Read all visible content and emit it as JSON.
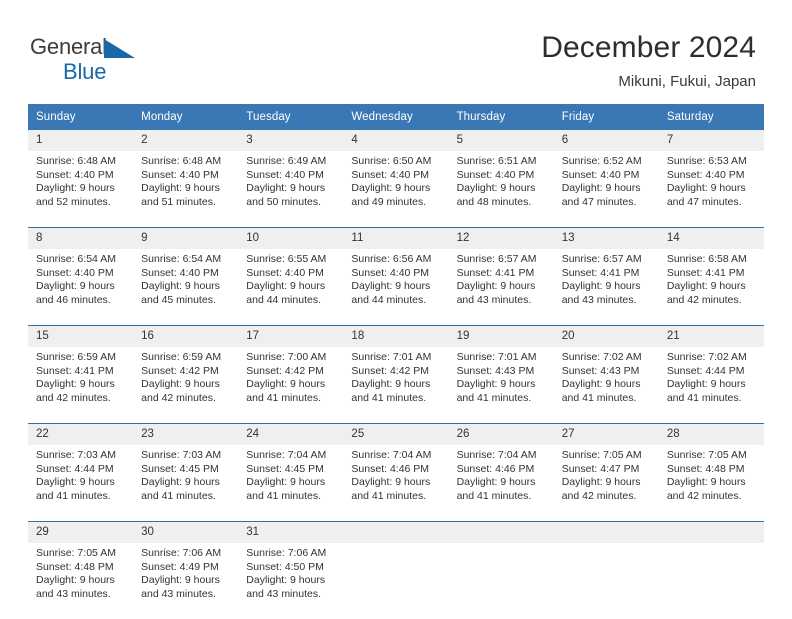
{
  "brand": {
    "name_part1": "General",
    "name_part2": "Blue",
    "logo_icon": "blue-triangle-flag-icon",
    "color_primary": "#1769aa"
  },
  "header": {
    "title": "December 2024",
    "subtitle": "Mikuni, Fukui, Japan"
  },
  "colors": {
    "header_blue": "#3a78b5",
    "separator_blue": "#2f6daf",
    "daynum_band": "#efefef",
    "text": "#333333"
  },
  "weekday_headers": [
    "Sunday",
    "Monday",
    "Tuesday",
    "Wednesday",
    "Thursday",
    "Friday",
    "Saturday"
  ],
  "weeks": [
    {
      "days": [
        {
          "num": "1",
          "sunrise": "Sunrise: 6:48 AM",
          "sunset": "Sunset: 4:40 PM",
          "daylight1": "Daylight: 9 hours",
          "daylight2": "and 52 minutes."
        },
        {
          "num": "2",
          "sunrise": "Sunrise: 6:48 AM",
          "sunset": "Sunset: 4:40 PM",
          "daylight1": "Daylight: 9 hours",
          "daylight2": "and 51 minutes."
        },
        {
          "num": "3",
          "sunrise": "Sunrise: 6:49 AM",
          "sunset": "Sunset: 4:40 PM",
          "daylight1": "Daylight: 9 hours",
          "daylight2": "and 50 minutes."
        },
        {
          "num": "4",
          "sunrise": "Sunrise: 6:50 AM",
          "sunset": "Sunset: 4:40 PM",
          "daylight1": "Daylight: 9 hours",
          "daylight2": "and 49 minutes."
        },
        {
          "num": "5",
          "sunrise": "Sunrise: 6:51 AM",
          "sunset": "Sunset: 4:40 PM",
          "daylight1": "Daylight: 9 hours",
          "daylight2": "and 48 minutes."
        },
        {
          "num": "6",
          "sunrise": "Sunrise: 6:52 AM",
          "sunset": "Sunset: 4:40 PM",
          "daylight1": "Daylight: 9 hours",
          "daylight2": "and 47 minutes."
        },
        {
          "num": "7",
          "sunrise": "Sunrise: 6:53 AM",
          "sunset": "Sunset: 4:40 PM",
          "daylight1": "Daylight: 9 hours",
          "daylight2": "and 47 minutes."
        }
      ]
    },
    {
      "days": [
        {
          "num": "8",
          "sunrise": "Sunrise: 6:54 AM",
          "sunset": "Sunset: 4:40 PM",
          "daylight1": "Daylight: 9 hours",
          "daylight2": "and 46 minutes."
        },
        {
          "num": "9",
          "sunrise": "Sunrise: 6:54 AM",
          "sunset": "Sunset: 4:40 PM",
          "daylight1": "Daylight: 9 hours",
          "daylight2": "and 45 minutes."
        },
        {
          "num": "10",
          "sunrise": "Sunrise: 6:55 AM",
          "sunset": "Sunset: 4:40 PM",
          "daylight1": "Daylight: 9 hours",
          "daylight2": "and 44 minutes."
        },
        {
          "num": "11",
          "sunrise": "Sunrise: 6:56 AM",
          "sunset": "Sunset: 4:40 PM",
          "daylight1": "Daylight: 9 hours",
          "daylight2": "and 44 minutes."
        },
        {
          "num": "12",
          "sunrise": "Sunrise: 6:57 AM",
          "sunset": "Sunset: 4:41 PM",
          "daylight1": "Daylight: 9 hours",
          "daylight2": "and 43 minutes."
        },
        {
          "num": "13",
          "sunrise": "Sunrise: 6:57 AM",
          "sunset": "Sunset: 4:41 PM",
          "daylight1": "Daylight: 9 hours",
          "daylight2": "and 43 minutes."
        },
        {
          "num": "14",
          "sunrise": "Sunrise: 6:58 AM",
          "sunset": "Sunset: 4:41 PM",
          "daylight1": "Daylight: 9 hours",
          "daylight2": "and 42 minutes."
        }
      ]
    },
    {
      "days": [
        {
          "num": "15",
          "sunrise": "Sunrise: 6:59 AM",
          "sunset": "Sunset: 4:41 PM",
          "daylight1": "Daylight: 9 hours",
          "daylight2": "and 42 minutes."
        },
        {
          "num": "16",
          "sunrise": "Sunrise: 6:59 AM",
          "sunset": "Sunset: 4:42 PM",
          "daylight1": "Daylight: 9 hours",
          "daylight2": "and 42 minutes."
        },
        {
          "num": "17",
          "sunrise": "Sunrise: 7:00 AM",
          "sunset": "Sunset: 4:42 PM",
          "daylight1": "Daylight: 9 hours",
          "daylight2": "and 41 minutes."
        },
        {
          "num": "18",
          "sunrise": "Sunrise: 7:01 AM",
          "sunset": "Sunset: 4:42 PM",
          "daylight1": "Daylight: 9 hours",
          "daylight2": "and 41 minutes."
        },
        {
          "num": "19",
          "sunrise": "Sunrise: 7:01 AM",
          "sunset": "Sunset: 4:43 PM",
          "daylight1": "Daylight: 9 hours",
          "daylight2": "and 41 minutes."
        },
        {
          "num": "20",
          "sunrise": "Sunrise: 7:02 AM",
          "sunset": "Sunset: 4:43 PM",
          "daylight1": "Daylight: 9 hours",
          "daylight2": "and 41 minutes."
        },
        {
          "num": "21",
          "sunrise": "Sunrise: 7:02 AM",
          "sunset": "Sunset: 4:44 PM",
          "daylight1": "Daylight: 9 hours",
          "daylight2": "and 41 minutes."
        }
      ]
    },
    {
      "days": [
        {
          "num": "22",
          "sunrise": "Sunrise: 7:03 AM",
          "sunset": "Sunset: 4:44 PM",
          "daylight1": "Daylight: 9 hours",
          "daylight2": "and 41 minutes."
        },
        {
          "num": "23",
          "sunrise": "Sunrise: 7:03 AM",
          "sunset": "Sunset: 4:45 PM",
          "daylight1": "Daylight: 9 hours",
          "daylight2": "and 41 minutes."
        },
        {
          "num": "24",
          "sunrise": "Sunrise: 7:04 AM",
          "sunset": "Sunset: 4:45 PM",
          "daylight1": "Daylight: 9 hours",
          "daylight2": "and 41 minutes."
        },
        {
          "num": "25",
          "sunrise": "Sunrise: 7:04 AM",
          "sunset": "Sunset: 4:46 PM",
          "daylight1": "Daylight: 9 hours",
          "daylight2": "and 41 minutes."
        },
        {
          "num": "26",
          "sunrise": "Sunrise: 7:04 AM",
          "sunset": "Sunset: 4:46 PM",
          "daylight1": "Daylight: 9 hours",
          "daylight2": "and 41 minutes."
        },
        {
          "num": "27",
          "sunrise": "Sunrise: 7:05 AM",
          "sunset": "Sunset: 4:47 PM",
          "daylight1": "Daylight: 9 hours",
          "daylight2": "and 42 minutes."
        },
        {
          "num": "28",
          "sunrise": "Sunrise: 7:05 AM",
          "sunset": "Sunset: 4:48 PM",
          "daylight1": "Daylight: 9 hours",
          "daylight2": "and 42 minutes."
        }
      ]
    },
    {
      "days": [
        {
          "num": "29",
          "sunrise": "Sunrise: 7:05 AM",
          "sunset": "Sunset: 4:48 PM",
          "daylight1": "Daylight: 9 hours",
          "daylight2": "and 43 minutes."
        },
        {
          "num": "30",
          "sunrise": "Sunrise: 7:06 AM",
          "sunset": "Sunset: 4:49 PM",
          "daylight1": "Daylight: 9 hours",
          "daylight2": "and 43 minutes."
        },
        {
          "num": "31",
          "sunrise": "Sunrise: 7:06 AM",
          "sunset": "Sunset: 4:50 PM",
          "daylight1": "Daylight: 9 hours",
          "daylight2": "and 43 minutes."
        },
        {
          "num": "",
          "sunrise": "",
          "sunset": "",
          "daylight1": "",
          "daylight2": ""
        },
        {
          "num": "",
          "sunrise": "",
          "sunset": "",
          "daylight1": "",
          "daylight2": ""
        },
        {
          "num": "",
          "sunrise": "",
          "sunset": "",
          "daylight1": "",
          "daylight2": ""
        },
        {
          "num": "",
          "sunrise": "",
          "sunset": "",
          "daylight1": "",
          "daylight2": ""
        }
      ]
    }
  ]
}
